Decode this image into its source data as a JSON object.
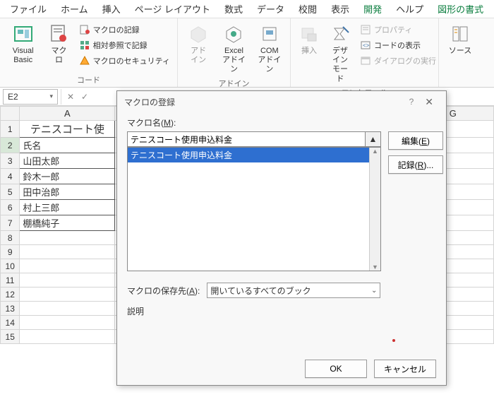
{
  "menu": {
    "items": [
      "ファイル",
      "ホーム",
      "挿入",
      "ページ レイアウト",
      "数式",
      "データ",
      "校閲",
      "表示",
      "開発",
      "ヘルプ",
      "図形の書式"
    ],
    "active_index": 8,
    "green_index": 10
  },
  "ribbon": {
    "group1": {
      "label": "コード",
      "vb": "Visual Basic",
      "macros": "マクロ",
      "rec": "マクロの記録",
      "rel": "相対参照で記録",
      "sec": "マクロのセキュリティ"
    },
    "group2": {
      "label": "アドイン",
      "addin": "アド\nイン",
      "excel": "Excel\nアドイン",
      "com": "COM\nアドイン"
    },
    "group3": {
      "label": "コントロール",
      "insert": "挿入",
      "design": "デザイン\nモード",
      "prop": "プロパティ",
      "code": "コードの表示",
      "dlg": "ダイアログの実行"
    },
    "group4": {
      "src": "ソース"
    }
  },
  "namebox": "E2",
  "columns": [
    "A",
    "G"
  ],
  "rows": {
    "1": "テニスコート使",
    "2": "氏名",
    "3": "山田太郎",
    "4": "鈴木一郎",
    "5": "田中治郎",
    "6": "村上三郎",
    "7": "棚橋純子"
  },
  "row_numbers": [
    "1",
    "2",
    "3",
    "4",
    "5",
    "6",
    "7",
    "8",
    "9",
    "10",
    "11",
    "12",
    "13",
    "14",
    "15"
  ],
  "dialog": {
    "title": "マクロの登録",
    "macro_label": "マクロ名(M):",
    "macro_name": "テニスコート使用申込料金",
    "list_item": "テニスコート使用申込料金",
    "edit": "編集(E)",
    "record": "記録(R)...",
    "save_label": "マクロの保存先(A):",
    "save_value": "開いているすべてのブック",
    "desc": "説明",
    "ok": "OK",
    "cancel": "キャンセル"
  }
}
